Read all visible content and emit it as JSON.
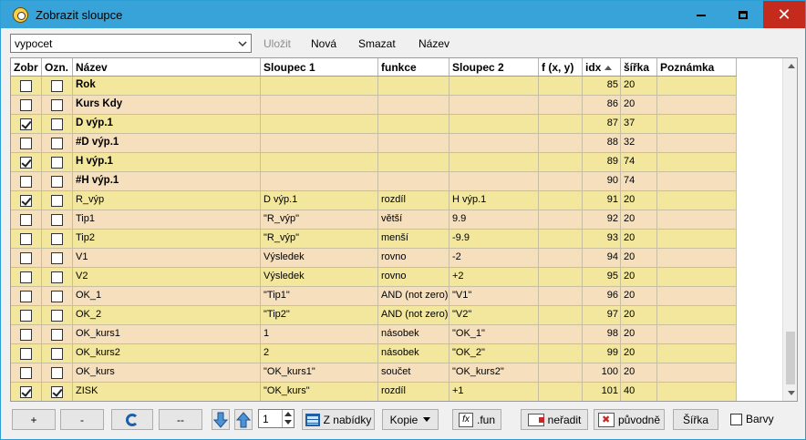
{
  "window": {
    "title": "Zobrazit sloupce"
  },
  "toolbar": {
    "combo_value": "vypocet",
    "save_label": "Uložit",
    "new_label": "Nová",
    "delete_label": "Smazat",
    "name_label": "Název"
  },
  "columns": [
    "Zobr",
    "Ozn.",
    "Název",
    "Sloupec 1",
    "funkce",
    "Sloupec 2",
    "f (x, y)",
    "idx",
    "šířka",
    "Poznámka"
  ],
  "rows": [
    {
      "zobr": false,
      "ozn": false,
      "nazev": "Rok",
      "bold": true,
      "s1": "",
      "funkce": "",
      "s2": "",
      "fxy": "",
      "idx": "85",
      "sirka": "20",
      "pozn": "",
      "tone": "yellow"
    },
    {
      "zobr": false,
      "ozn": false,
      "nazev": "Kurs Kdy",
      "bold": true,
      "s1": "",
      "funkce": "",
      "s2": "",
      "fxy": "",
      "idx": "86",
      "sirka": "20",
      "pozn": "",
      "tone": "light"
    },
    {
      "zobr": true,
      "ozn": false,
      "nazev": "D výp.1",
      "bold": true,
      "s1": "",
      "funkce": "",
      "s2": "",
      "fxy": "",
      "idx": "87",
      "sirka": "37",
      "pozn": "",
      "tone": "yellow"
    },
    {
      "zobr": false,
      "ozn": false,
      "nazev": "#D výp.1",
      "bold": true,
      "s1": "",
      "funkce": "",
      "s2": "",
      "fxy": "",
      "idx": "88",
      "sirka": "32",
      "pozn": "",
      "tone": "light"
    },
    {
      "zobr": true,
      "ozn": false,
      "nazev": "H výp.1",
      "bold": true,
      "s1": "",
      "funkce": "",
      "s2": "",
      "fxy": "",
      "idx": "89",
      "sirka": "74",
      "pozn": "",
      "tone": "yellow"
    },
    {
      "zobr": false,
      "ozn": false,
      "nazev": "#H výp.1",
      "bold": true,
      "s1": "",
      "funkce": "",
      "s2": "",
      "fxy": "",
      "idx": "90",
      "sirka": "74",
      "pozn": "",
      "tone": "light"
    },
    {
      "zobr": true,
      "ozn": false,
      "nazev": "R_výp",
      "bold": false,
      "s1": "D výp.1",
      "funkce": "rozdíl",
      "s2": "H výp.1",
      "fxy": "",
      "idx": "91",
      "sirka": "20",
      "pozn": "",
      "tone": "yellow"
    },
    {
      "zobr": false,
      "ozn": false,
      "nazev": "Tip1",
      "bold": false,
      "s1": "\"R_výp\"",
      "funkce": "větší",
      "s2": "9.9",
      "fxy": "",
      "idx": "92",
      "sirka": "20",
      "pozn": "",
      "tone": "light"
    },
    {
      "zobr": false,
      "ozn": false,
      "nazev": "Tip2",
      "bold": false,
      "s1": "\"R_výp\"",
      "funkce": "menší",
      "s2": "-9.9",
      "fxy": "",
      "idx": "93",
      "sirka": "20",
      "pozn": "",
      "tone": "yellow"
    },
    {
      "zobr": false,
      "ozn": false,
      "nazev": "V1",
      "bold": false,
      "s1": "Výsledek",
      "funkce": "rovno",
      "s2": "-2",
      "fxy": "",
      "idx": "94",
      "sirka": "20",
      "pozn": "",
      "tone": "light"
    },
    {
      "zobr": false,
      "ozn": false,
      "nazev": "V2",
      "bold": false,
      "s1": "Výsledek",
      "funkce": "rovno",
      "s2": "+2",
      "fxy": "",
      "idx": "95",
      "sirka": "20",
      "pozn": "",
      "tone": "yellow"
    },
    {
      "zobr": false,
      "ozn": false,
      "nazev": "OK_1",
      "bold": false,
      "s1": "\"Tip1\"",
      "funkce": "AND (not zero)",
      "s2": "\"V1\"",
      "fxy": "",
      "idx": "96",
      "sirka": "20",
      "pozn": "",
      "tone": "light"
    },
    {
      "zobr": false,
      "ozn": false,
      "nazev": "OK_2",
      "bold": false,
      "s1": "\"Tip2\"",
      "funkce": "AND (not zero)",
      "s2": "\"V2\"",
      "fxy": "",
      "idx": "97",
      "sirka": "20",
      "pozn": "",
      "tone": "yellow"
    },
    {
      "zobr": false,
      "ozn": false,
      "nazev": "OK_kurs1",
      "bold": false,
      "s1": "1",
      "funkce": "násobek",
      "s2": "\"OK_1\"",
      "fxy": "",
      "idx": "98",
      "sirka": "20",
      "pozn": "",
      "tone": "light"
    },
    {
      "zobr": false,
      "ozn": false,
      "nazev": "OK_kurs2",
      "bold": false,
      "s1": "2",
      "funkce": "násobek",
      "s2": "\"OK_2\"",
      "fxy": "",
      "idx": "99",
      "sirka": "20",
      "pozn": "",
      "tone": "yellow"
    },
    {
      "zobr": false,
      "ozn": false,
      "nazev": "OK_kurs",
      "bold": false,
      "s1": "\"OK_kurs1\"",
      "funkce": "součet",
      "s2": "\"OK_kurs2\"",
      "fxy": "",
      "idx": "100",
      "sirka": "20",
      "pozn": "",
      "tone": "light"
    },
    {
      "zobr": true,
      "ozn": true,
      "nazev": "ZISK",
      "bold": false,
      "s1": "\"OK_kurs\"",
      "funkce": "rozdíl",
      "s2": "+1",
      "fxy": "",
      "idx": "101",
      "sirka": "40",
      "pozn": "",
      "tone": "yellow"
    }
  ],
  "bottom": {
    "add_label": "+",
    "remove_label": "-",
    "dashes_label": "--",
    "spin_value": "1",
    "from_menu_label": "Z nabídky",
    "copy_label": "Kopie",
    "fun_label": ".fun",
    "unsort_label": "neřadit",
    "original_label": "původně",
    "width_label": "Šířka",
    "colors_label": "Barvy"
  },
  "colors": {
    "title_bar": "#37a3d8",
    "row_yellow": "#f2e79c",
    "row_light": "#f5dfbd",
    "close_red": "#c42b1c"
  }
}
